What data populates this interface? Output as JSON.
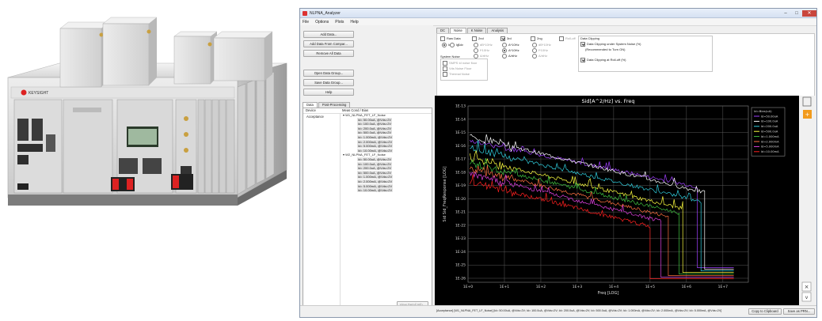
{
  "window": {
    "title": "NLPNA_Analyzer",
    "menu": [
      "File",
      "Options",
      "Plots",
      "Help"
    ]
  },
  "left_panel": {
    "buttons": [
      "Add Data...",
      "Add Data From Compar...",
      "Remove All Data",
      "Open Data Group...",
      "Save Data Group...",
      "Help"
    ],
    "tabs": [
      "Data",
      "Post-Processing"
    ],
    "columns": [
      "Device",
      "Meas Cond / Bias"
    ],
    "device": "Acceptance",
    "groups": [
      {
        "name": "W1_NLPNA_FET_LF_Noise",
        "items": [
          "Id= 50.00uA, @Vds=2V",
          "Id= 100.0uA, @Vds=2V",
          "Id= 200.0uA, @Vds=2V",
          "Id= 500.0uA, @Vds=2V",
          "Id= 1.000mA, @Vds=2V",
          "Id= 2.000mA, @Vds=2V",
          "Id= 5.000mA, @Vds=2V",
          "Id= 10.00mA, @Vds=2V"
        ]
      },
      {
        "name": "W2_NLPNA_FET_LF_Noise",
        "items": [
          "Id= 50.00uA, @Vds=2V",
          "Id= 100.0uA, @Vds=2V",
          "Id= 200.0uA, @Vds=2V",
          "Id= 500.0uA, @Vds=2V",
          "Id= 1.000mA, @Vds=2V",
          "Id= 2.000mA, @Vds=2V",
          "Id= 5.000mA, @Vds=2V",
          "Id= 10.00mA, @Vds=2V"
        ]
      }
    ],
    "view_detail_button": "View Detail Info..."
  },
  "right_panel": {
    "tabs": [
      "DC",
      "Noise",
      "K Noise",
      "Analysis"
    ],
    "raw_data": {
      "label": "Raw Data",
      "checked": false,
      "radio": [
        "Id",
        "Ig",
        "Sdv"
      ]
    },
    "harmonics": [
      {
        "label": "2nd",
        "checked": false,
        "options": [
          "dB*10Hz",
          "f*10Hz",
          "A/rtHz"
        ]
      },
      {
        "label": "3rd",
        "checked": true,
        "options": [
          "A*10Hz",
          "A*10Hz",
          "A/rtHz"
        ]
      },
      {
        "label": "2ng",
        "checked": false,
        "options": [
          "dB*10Hz",
          "f*10Hz",
          "A/rtHz"
        ]
      }
    ],
    "rolloff": "Roll-off",
    "system_noise": {
      "label": "System Noise",
      "options": [
        "SMPS Id noise floor",
        "Vds Noise Floor",
        "Thermal Noise"
      ]
    },
    "data_clipping": {
      "title": "Data Clipping",
      "options": [
        "Data Clipping under System Noise (%)",
        "(Recommended to Turn ON)",
        "Data Clipping at Roll-off (%)"
      ]
    }
  },
  "chart_data": {
    "type": "line",
    "title": "Sid[A^2/Hz] vs. Freq",
    "xlabel": "Freq [LOG]",
    "ylabel": "Sid Sid_FreqResponse [LOG]",
    "x_ticks": [
      "1E+0",
      "1E+1",
      "1E+2",
      "1E+3",
      "1E+4",
      "1E+5",
      "1E+6",
      "1E+7"
    ],
    "y_ticks": [
      "1E-13",
      "1E-14",
      "1E-15",
      "1E-16",
      "1E-17",
      "1E-18",
      "1E-19",
      "1E-20",
      "1E-21",
      "1E-22",
      "1E-23",
      "1E-24",
      "1E-25",
      "1E-26"
    ],
    "xlim_log": [
      0,
      7.7
    ],
    "ylim_log": [
      -26.3,
      -13
    ],
    "grid": true,
    "legend_title": "Id=Bias(uA)",
    "series": [
      {
        "name": "Id=50.00uA",
        "color": "#a040ff",
        "start": -15.6,
        "end": -19.6,
        "cut_x": 6.3
      },
      {
        "name": "Id=100.0uA",
        "color": "#ffffff",
        "start": -15.3,
        "end": -20.0,
        "cut_x": 6.5
      },
      {
        "name": "Id=200.0uA",
        "color": "#30d0e0",
        "start": -16.2,
        "end": -20.7,
        "cut_x": 6.4
      },
      {
        "name": "Id=500.0uA",
        "color": "#ffff40",
        "start": -16.9,
        "end": -21.6,
        "cut_x": 5.9
      },
      {
        "name": "Id=1.000mA",
        "color": "#40c040",
        "start": -17.3,
        "end": -22.0,
        "cut_x": 5.8
      },
      {
        "name": "Id=2.000mA",
        "color": "#ff7040",
        "start": -17.7,
        "end": -22.5,
        "cut_x": 5.5
      },
      {
        "name": "Id=5.000mA",
        "color": "#e040e0",
        "start": -18.1,
        "end": -23.0,
        "cut_x": 5.3
      },
      {
        "name": "Id=10.00mA",
        "color": "#ff2020",
        "start": -18.7,
        "end": -23.6,
        "cut_x": 5.0
      }
    ]
  },
  "status_bar": {
    "text": "[Acceptance] [W1_NLPNA_FET_LF_Noise] [Id= 50.00uA, @Vds=2V; Id= 100.0uA, @Vds=2V; Id= 200.0uA, @Vds=2V; Id= 500.0uA, @Vds=2V; Id= 1.000mA, @Vds=2V; Id= 2.000mA, @Vds=2V; Id= 5.000mA, @Vds=2V]",
    "copy_button": "Copy to Clipboard",
    "save_button": "Save as PRN..."
  }
}
